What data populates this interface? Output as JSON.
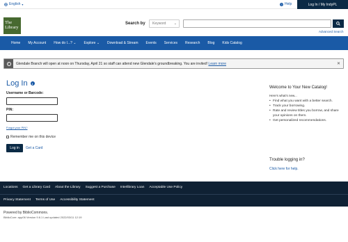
{
  "topbar": {
    "language": "English",
    "help": "Help",
    "login": "Log In / My IndyPL"
  },
  "header": {
    "logo_line1": "The",
    "logo_line2": "Library",
    "search_by": "Search by",
    "search_type": "Keyword",
    "search_placeholder": "",
    "advanced_search": "Advanced Search"
  },
  "nav": {
    "items": [
      "Home",
      "My Account",
      "How do I...?",
      "Explore",
      "Download & Stream",
      "Events",
      "Services",
      "Research",
      "Blog",
      "Kids Catalog"
    ]
  },
  "alert": {
    "text": "Glendale Branch will open at noon on Thursday, April 21 so staff can attend new Glendale's groundbreaking. You are invited!",
    "link": "Learn more"
  },
  "login": {
    "title": "Log In",
    "username_label": "Username or Barcode:",
    "pin_label": "PIN:",
    "forgot_pin": "Forgot your PIN?",
    "remember": "Remember me on this device",
    "button": "Log in",
    "get_card": "Get a Card"
  },
  "welcome": {
    "title": "Welcome to Your New Catalog!",
    "intro": "Here's what's new...",
    "items": [
      "Find what you want with a better search.",
      "Track your borrowing.",
      "Rate and review titles you borrow, and share your opinions on them.",
      "Get personalized recommendations."
    ],
    "trouble_title": "Trouble logging in?",
    "help_link": "Click here for help."
  },
  "footer": {
    "row1": [
      "Locations",
      "Get a Library Card",
      "About the Library",
      "Suggest a Purchase",
      "Interlibrary Loan",
      "Acceptable Use Policy"
    ],
    "row2": [
      "Privacy Statement",
      "Terms of Use",
      "Accessibility Statement"
    ],
    "powered": "Powered by BiblioCommons.",
    "version": "BiblioCore: app06 Version 9.6.1 Last updated 2022/03/11 12:19"
  },
  "colors": {
    "primary_blue": "#1a5aa6",
    "navy": "#0b2a45",
    "logo_green": "#476930",
    "footer_bg": "#0f2134"
  }
}
